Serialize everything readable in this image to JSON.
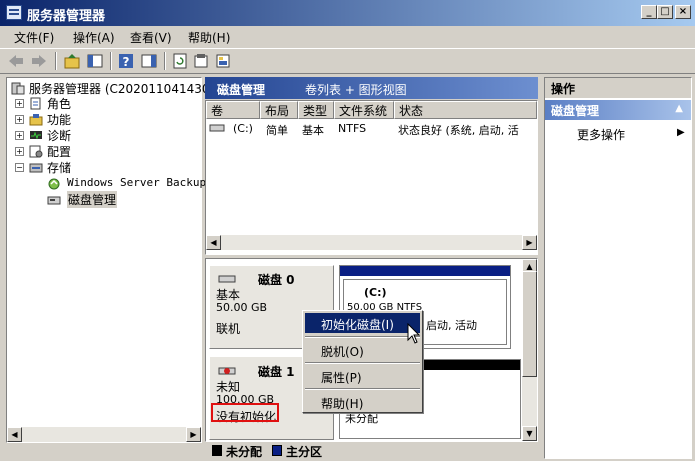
{
  "window": {
    "title": "服务器管理器",
    "controls": {
      "minimize": "_",
      "maximize": "□",
      "close": "×"
    }
  },
  "menu": [
    {
      "label": "文件(F)"
    },
    {
      "label": "操作(A)"
    },
    {
      "label": "查看(V)"
    },
    {
      "label": "帮助(H)"
    }
  ],
  "tree": {
    "root": "服务器管理器 (C20201104143071",
    "items": [
      {
        "label": "角色",
        "icon": "roles-icon"
      },
      {
        "label": "功能",
        "icon": "features-icon"
      },
      {
        "label": "诊断",
        "icon": "diagnostics-icon"
      },
      {
        "label": "配置",
        "icon": "configuration-icon"
      },
      {
        "label": "存储",
        "icon": "storage-icon"
      }
    ],
    "storage_children": [
      {
        "label": "Windows Server Backup"
      },
      {
        "label": "磁盘管理"
      }
    ]
  },
  "middle": {
    "title": "磁盘管理",
    "subtitle": "卷列表 + 图形视图",
    "columns": [
      "卷",
      "布局",
      "类型",
      "文件系统",
      "状态"
    ],
    "rows": [
      {
        "volume": "(C:)",
        "layout": "简单",
        "type": "基本",
        "fs": "NTFS",
        "status": "状态良好 (系统, 启动, 活"
      }
    ]
  },
  "disks": [
    {
      "name": "磁盘 0",
      "type": "基本",
      "size": "50.00 GB",
      "state": "联机",
      "partition": {
        "label": "(C:)",
        "detail": "50.00 GB NTFS",
        "status": "统, 启动, 活动"
      }
    },
    {
      "name": "磁盘 1",
      "type": "未知",
      "size": "100.00 GB",
      "state": "没有初始化",
      "partition": {
        "label": "未分配"
      }
    }
  ],
  "legend": {
    "unallocated": "未分配",
    "primary": "主分区"
  },
  "actions": {
    "header": "操作",
    "section": "磁盘管理",
    "more": "更多操作"
  },
  "context_menu": [
    {
      "label": "初始化磁盘(I)",
      "highlighted": true
    },
    {
      "label": "脱机(O)"
    },
    {
      "label": "属性(P)"
    },
    {
      "label": "帮助(H)"
    }
  ],
  "colors": {
    "titlebar": "#0a246a",
    "disk_bar": "#0a1f84",
    "highlight_box": "#e01010"
  }
}
